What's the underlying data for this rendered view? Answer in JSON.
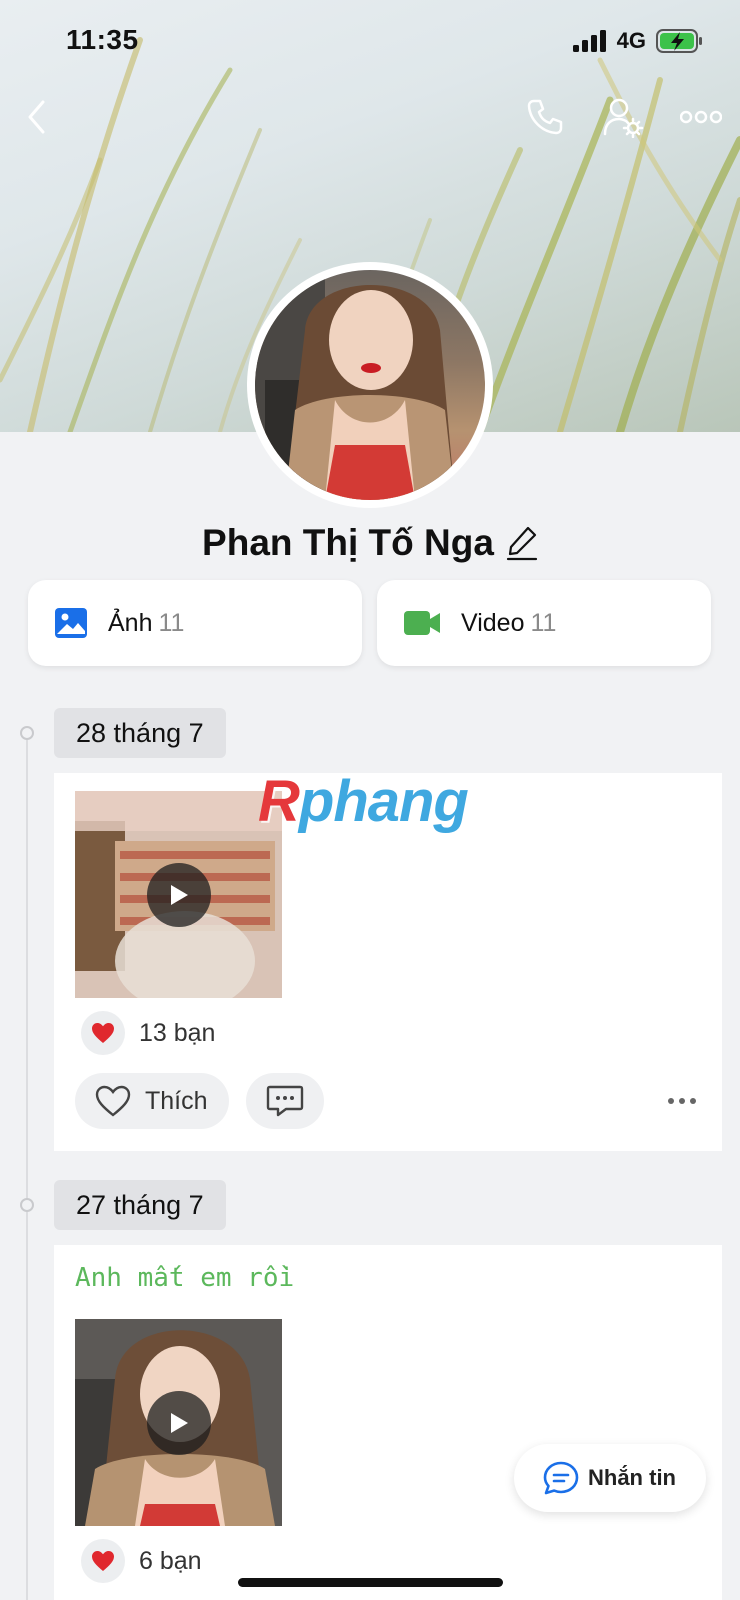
{
  "status_bar": {
    "time": "11:35",
    "network": "4G"
  },
  "profile": {
    "name": "Phan Thị Tố Nga"
  },
  "media": [
    {
      "label": "Ảnh",
      "count": "11"
    },
    {
      "label": "Video",
      "count": "11"
    }
  ],
  "watermark": {
    "prefix": "R",
    "rest": "phang"
  },
  "posts": [
    {
      "date": "28 tháng 7",
      "likes": "13 bạn",
      "like_label": "Thích"
    },
    {
      "date": "27 tháng 7",
      "caption": "Anh mất em rồi",
      "likes": "6 bạn"
    }
  ],
  "message_button": {
    "label": "Nhắn tin"
  },
  "colors": {
    "accent_blue": "#1a6fe8",
    "video_green": "#4caf50",
    "caption_green": "#5cb85c",
    "heart_red": "#e0282e"
  }
}
